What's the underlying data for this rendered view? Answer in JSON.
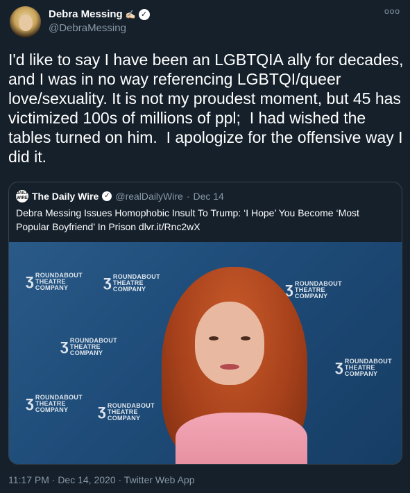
{
  "author": {
    "name": "Debra Messing",
    "emoji": "✍🏻",
    "handle": "@DebraMessing",
    "verified_glyph": "✓"
  },
  "more_glyph": "ooo",
  "tweet_text": "I'd like to say I have been an LGBTQIA ally for decades, and I was in no way referencing LGBTQI/queer love/sexuality. It is not my proudest moment, but 45 has victimized 100s of millions of ppl;  I had wished the tables turned on him.  I apologize for the offensive way I did it.",
  "quoted": {
    "logo_text": "DAILY WIRE",
    "name": "The Daily Wire",
    "verified_glyph": "✓",
    "handle": "@realDailyWire",
    "separator": "·",
    "date": "Dec 14",
    "text": "Debra Messing Issues Homophobic Insult To Trump: ‘I Hope’ You Become ‘Most Popular Boyfriend’ In Prison dlvr.it/Rnc2wX",
    "backdrop_logo_line1": "ROUNDABOUT",
    "backdrop_logo_line2": "THEATRE",
    "backdrop_logo_line3": "COMPANY",
    "backdrop_mark": "ʒ"
  },
  "footer": {
    "text": "11:17 PM · Dec 14, 2020 · Twitter Web App"
  },
  "colors": {
    "background": "#15202b",
    "secondary_text": "#8899a6",
    "border": "#38444d"
  }
}
